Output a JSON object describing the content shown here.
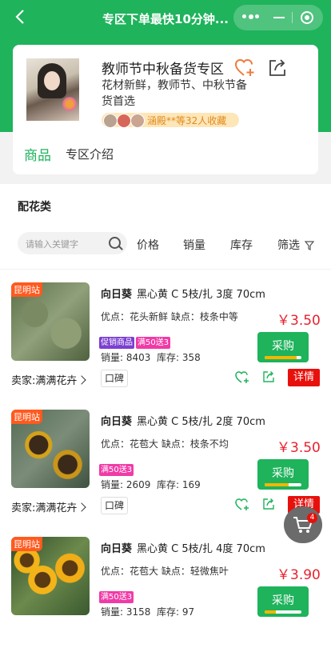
{
  "nav": {
    "title": "专区下单最快10分钟...",
    "back_icon": "back-arrow-icon",
    "menu_icon": "more-dots-icon",
    "minimize_icon": "minimize-icon",
    "close_icon": "target-close-icon"
  },
  "zone": {
    "title": "教师节中秋备货专区",
    "description": "花材新鲜，教师节、中秋节备货首选",
    "favorites_text": "涵殿**等32人收藏",
    "tabs": [
      "商品",
      "专区介绍"
    ]
  },
  "section": {
    "title": "配花类",
    "search_placeholder": "请输入关键字",
    "sort_options": [
      "价格",
      "销量",
      "库存",
      "筛选"
    ]
  },
  "products": [
    {
      "station": "昆明站",
      "name": "向日葵",
      "spec": "黑心黄 C 5枝/扎 3度 70cm",
      "merit": "优点：花头新鲜 缺点：枝条中等",
      "price": "￥3.50",
      "badges": [
        "促销商品",
        "满50送3"
      ],
      "sales": "销量: 8403",
      "stock": "库存: 358",
      "buy_label": "采购",
      "buy_progress": 0.88,
      "seller": "卖家:满满花卉",
      "koubei": "口碑",
      "detail": "详情"
    },
    {
      "station": "昆明站",
      "name": "向日葵",
      "spec": "黑心黄 C 5枝/扎 2度 70cm",
      "merit": "优点：花苞大 缺点：枝条不均",
      "price": "￥3.50",
      "badges": [
        "满50送3"
      ],
      "sales": "销量: 2609",
      "stock": "库存: 169",
      "buy_label": "采购",
      "buy_progress": 0.65,
      "seller": "卖家:满满花卉",
      "koubei": "口碑",
      "detail": "详情"
    },
    {
      "station": "昆明站",
      "name": "向日葵",
      "spec": "黑心黄 C 5枝/扎 4度 70cm",
      "merit": "优点：花苞大 缺点：轻微焦叶",
      "price": "￥3.90",
      "badges": [
        "满50送3"
      ],
      "sales": "销量: 3158",
      "stock": "库存: 97",
      "buy_label": "采购",
      "buy_progress": 0.3
    }
  ],
  "cart": {
    "count": "4",
    "icon": "cart-icon"
  },
  "colors": {
    "primary": "#1fb35c",
    "price": "#e8212d",
    "detail": "#e8100c",
    "station": "#ff5a1f",
    "promo": "#7b3fd1",
    "gift": "#f03ba7"
  }
}
